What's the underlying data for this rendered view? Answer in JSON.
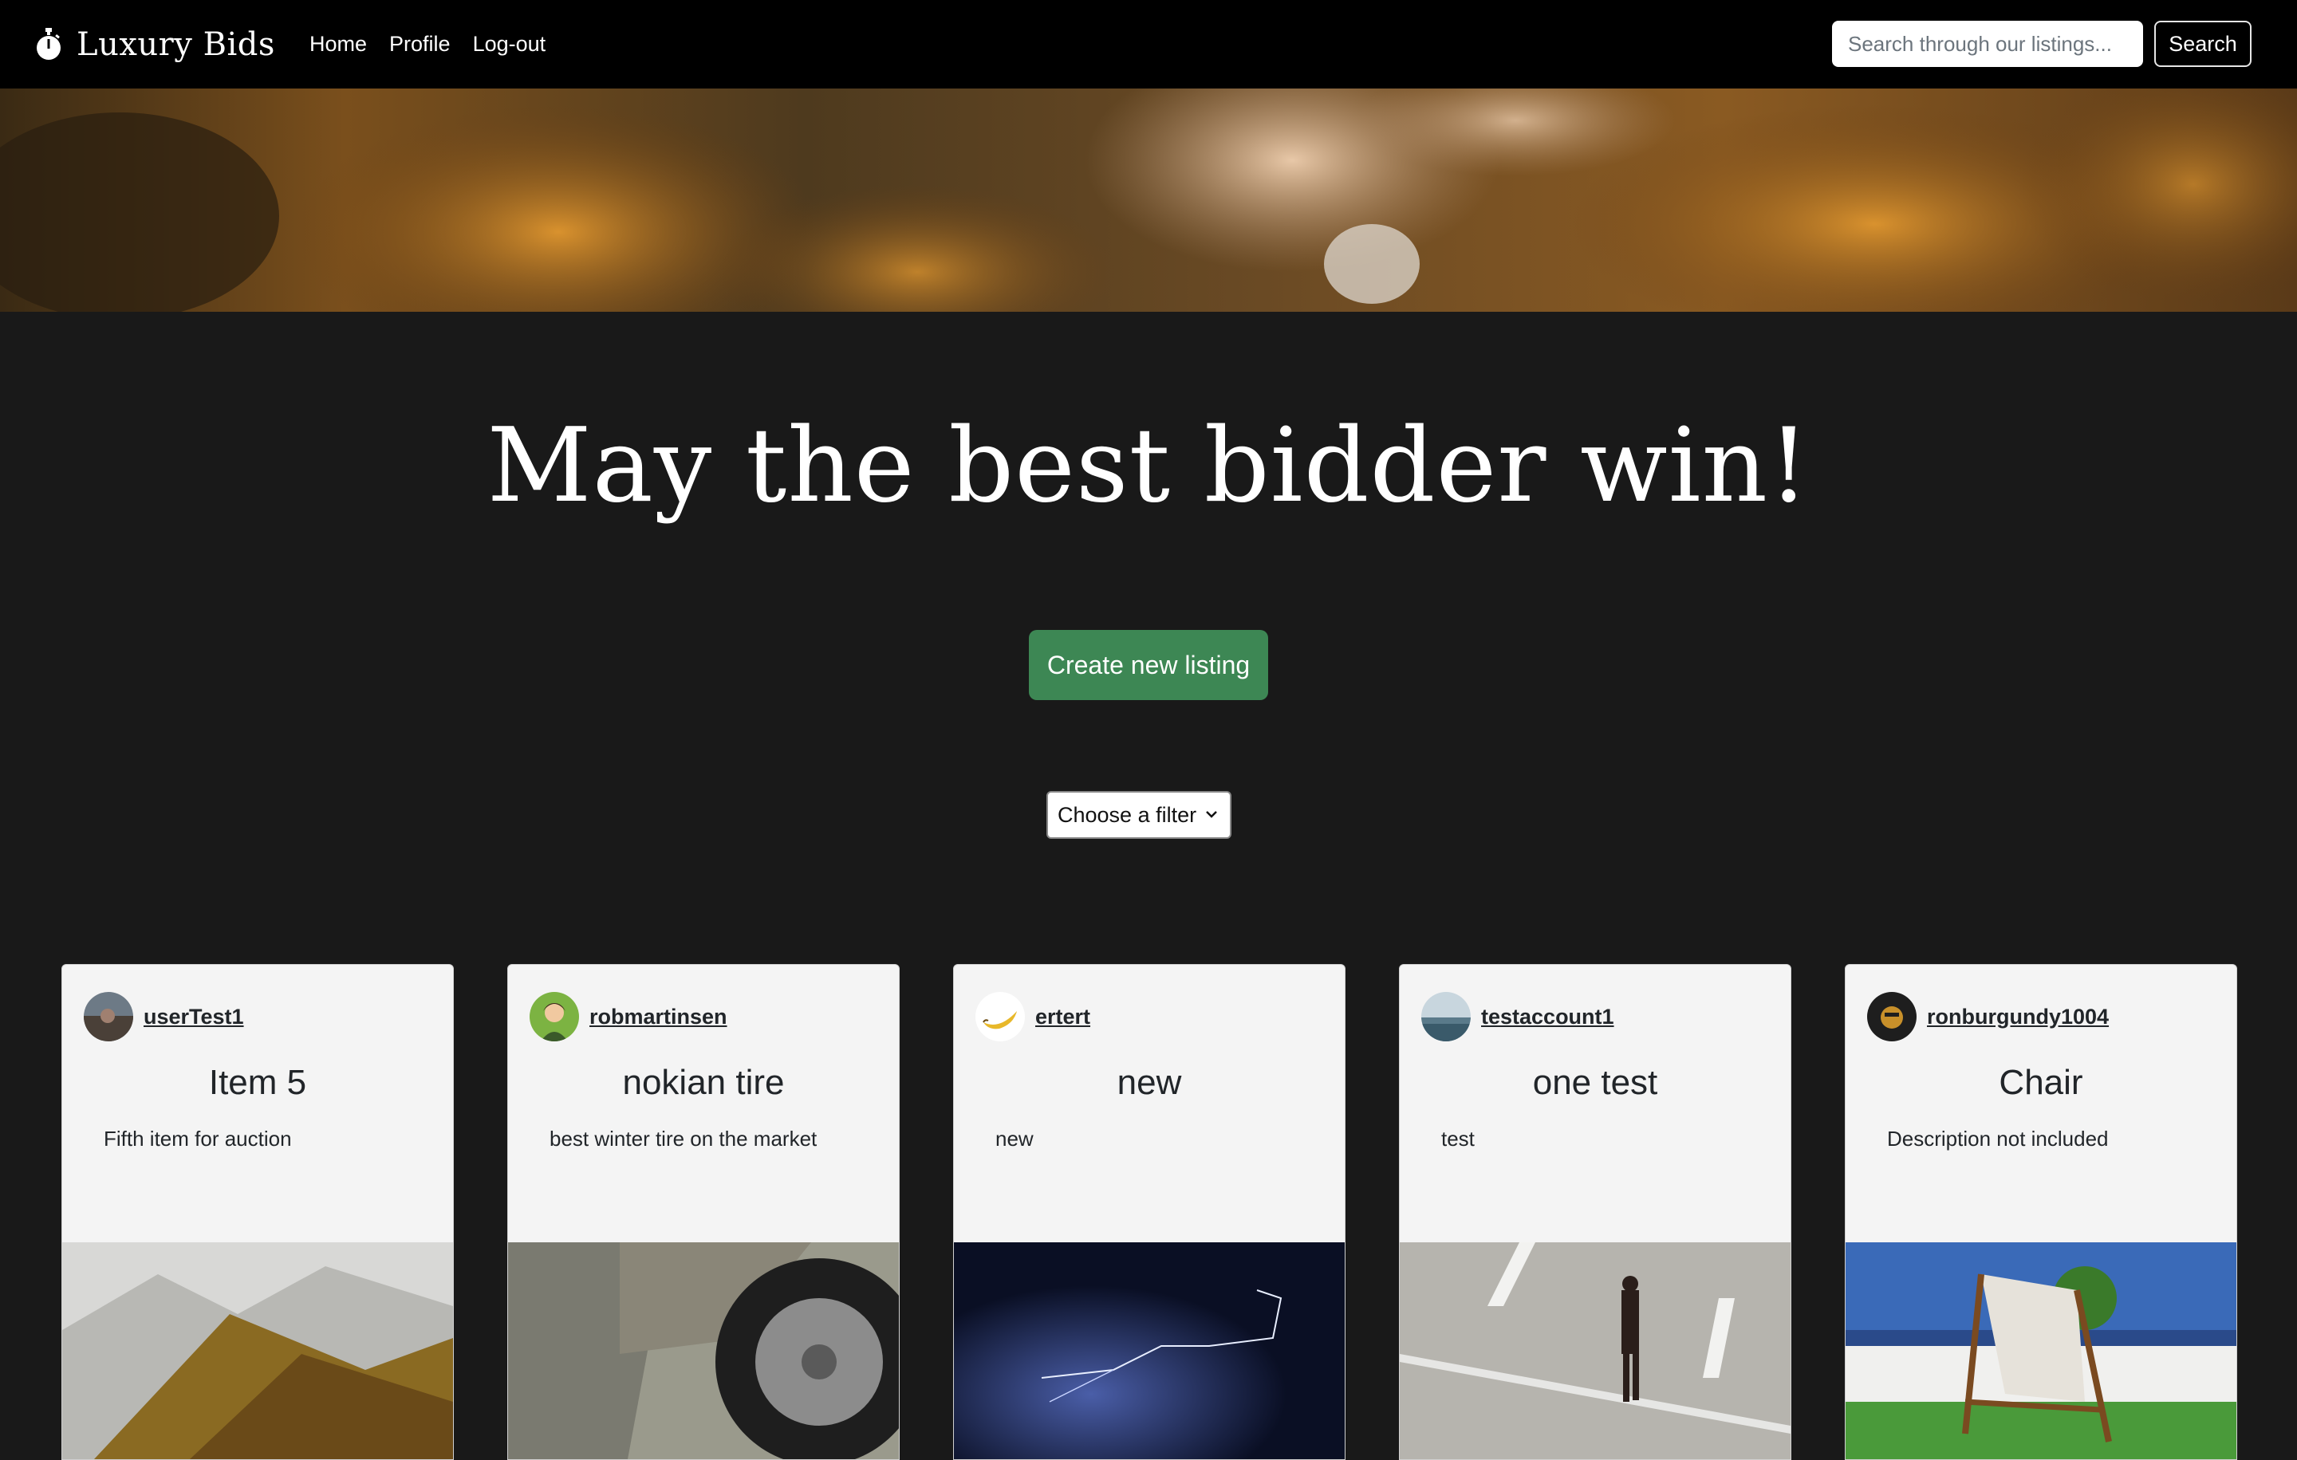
{
  "brand": {
    "name": "Luxury Bids",
    "icon": "stopwatch-icon"
  },
  "nav": {
    "items": [
      {
        "label": "Home"
      },
      {
        "label": "Profile"
      },
      {
        "label": "Log-out"
      }
    ]
  },
  "search": {
    "placeholder": "Search through our listings...",
    "button_label": "Search"
  },
  "hero": {
    "headline": "May the best bidder win!"
  },
  "actions": {
    "create_label": "Create new listing"
  },
  "filter": {
    "selected": "Choose a filter"
  },
  "colors": {
    "background": "#191919",
    "navbar": "#000000",
    "accent_green": "#3d8754",
    "card_bg": "#f4f4f4"
  },
  "listings": [
    {
      "username": "userTest1",
      "title": "Item 5",
      "description": "Fifth item for auction",
      "image": "mountain-forest-photo"
    },
    {
      "username": "robmartinsen",
      "title": "nokian tire",
      "description": "best winter tire on the market",
      "image": "suv-tire-photo"
    },
    {
      "username": "ertert",
      "title": "new",
      "description": "new",
      "image": "lightning-sky-photo"
    },
    {
      "username": "testaccount1",
      "title": "one test",
      "description": "test",
      "image": "man-walking-road-photo"
    },
    {
      "username": "ronburgundy1004",
      "title": "Chair",
      "description": "Description not included",
      "image": "beach-chair-photo"
    }
  ]
}
